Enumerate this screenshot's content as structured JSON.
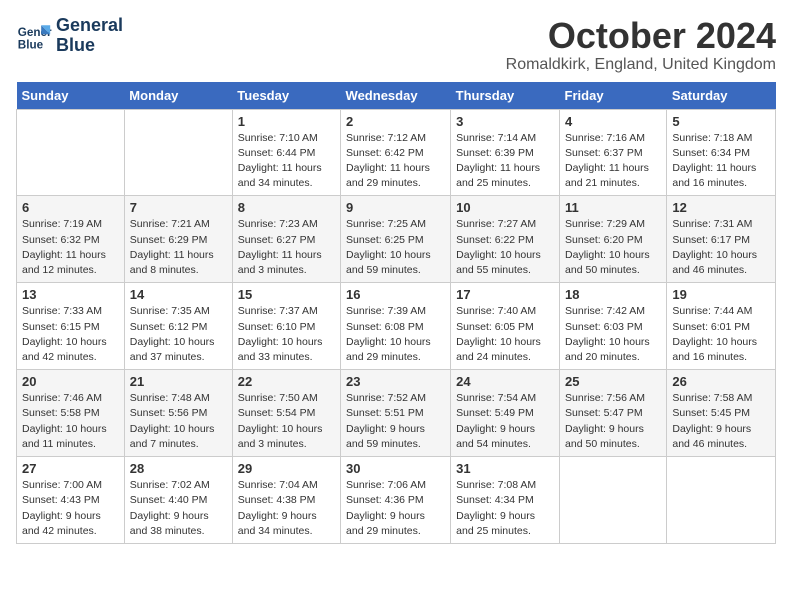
{
  "header": {
    "logo_line1": "General",
    "logo_line2": "Blue",
    "month_title": "October 2024",
    "location": "Romaldkirk, England, United Kingdom"
  },
  "weekdays": [
    "Sunday",
    "Monday",
    "Tuesday",
    "Wednesday",
    "Thursday",
    "Friday",
    "Saturday"
  ],
  "weeks": [
    [
      {
        "num": "",
        "info": ""
      },
      {
        "num": "",
        "info": ""
      },
      {
        "num": "1",
        "info": "Sunrise: 7:10 AM\nSunset: 6:44 PM\nDaylight: 11 hours\nand 34 minutes."
      },
      {
        "num": "2",
        "info": "Sunrise: 7:12 AM\nSunset: 6:42 PM\nDaylight: 11 hours\nand 29 minutes."
      },
      {
        "num": "3",
        "info": "Sunrise: 7:14 AM\nSunset: 6:39 PM\nDaylight: 11 hours\nand 25 minutes."
      },
      {
        "num": "4",
        "info": "Sunrise: 7:16 AM\nSunset: 6:37 PM\nDaylight: 11 hours\nand 21 minutes."
      },
      {
        "num": "5",
        "info": "Sunrise: 7:18 AM\nSunset: 6:34 PM\nDaylight: 11 hours\nand 16 minutes."
      }
    ],
    [
      {
        "num": "6",
        "info": "Sunrise: 7:19 AM\nSunset: 6:32 PM\nDaylight: 11 hours\nand 12 minutes."
      },
      {
        "num": "7",
        "info": "Sunrise: 7:21 AM\nSunset: 6:29 PM\nDaylight: 11 hours\nand 8 minutes."
      },
      {
        "num": "8",
        "info": "Sunrise: 7:23 AM\nSunset: 6:27 PM\nDaylight: 11 hours\nand 3 minutes."
      },
      {
        "num": "9",
        "info": "Sunrise: 7:25 AM\nSunset: 6:25 PM\nDaylight: 10 hours\nand 59 minutes."
      },
      {
        "num": "10",
        "info": "Sunrise: 7:27 AM\nSunset: 6:22 PM\nDaylight: 10 hours\nand 55 minutes."
      },
      {
        "num": "11",
        "info": "Sunrise: 7:29 AM\nSunset: 6:20 PM\nDaylight: 10 hours\nand 50 minutes."
      },
      {
        "num": "12",
        "info": "Sunrise: 7:31 AM\nSunset: 6:17 PM\nDaylight: 10 hours\nand 46 minutes."
      }
    ],
    [
      {
        "num": "13",
        "info": "Sunrise: 7:33 AM\nSunset: 6:15 PM\nDaylight: 10 hours\nand 42 minutes."
      },
      {
        "num": "14",
        "info": "Sunrise: 7:35 AM\nSunset: 6:12 PM\nDaylight: 10 hours\nand 37 minutes."
      },
      {
        "num": "15",
        "info": "Sunrise: 7:37 AM\nSunset: 6:10 PM\nDaylight: 10 hours\nand 33 minutes."
      },
      {
        "num": "16",
        "info": "Sunrise: 7:39 AM\nSunset: 6:08 PM\nDaylight: 10 hours\nand 29 minutes."
      },
      {
        "num": "17",
        "info": "Sunrise: 7:40 AM\nSunset: 6:05 PM\nDaylight: 10 hours\nand 24 minutes."
      },
      {
        "num": "18",
        "info": "Sunrise: 7:42 AM\nSunset: 6:03 PM\nDaylight: 10 hours\nand 20 minutes."
      },
      {
        "num": "19",
        "info": "Sunrise: 7:44 AM\nSunset: 6:01 PM\nDaylight: 10 hours\nand 16 minutes."
      }
    ],
    [
      {
        "num": "20",
        "info": "Sunrise: 7:46 AM\nSunset: 5:58 PM\nDaylight: 10 hours\nand 11 minutes."
      },
      {
        "num": "21",
        "info": "Sunrise: 7:48 AM\nSunset: 5:56 PM\nDaylight: 10 hours\nand 7 minutes."
      },
      {
        "num": "22",
        "info": "Sunrise: 7:50 AM\nSunset: 5:54 PM\nDaylight: 10 hours\nand 3 minutes."
      },
      {
        "num": "23",
        "info": "Sunrise: 7:52 AM\nSunset: 5:51 PM\nDaylight: 9 hours\nand 59 minutes."
      },
      {
        "num": "24",
        "info": "Sunrise: 7:54 AM\nSunset: 5:49 PM\nDaylight: 9 hours\nand 54 minutes."
      },
      {
        "num": "25",
        "info": "Sunrise: 7:56 AM\nSunset: 5:47 PM\nDaylight: 9 hours\nand 50 minutes."
      },
      {
        "num": "26",
        "info": "Sunrise: 7:58 AM\nSunset: 5:45 PM\nDaylight: 9 hours\nand 46 minutes."
      }
    ],
    [
      {
        "num": "27",
        "info": "Sunrise: 7:00 AM\nSunset: 4:43 PM\nDaylight: 9 hours\nand 42 minutes."
      },
      {
        "num": "28",
        "info": "Sunrise: 7:02 AM\nSunset: 4:40 PM\nDaylight: 9 hours\nand 38 minutes."
      },
      {
        "num": "29",
        "info": "Sunrise: 7:04 AM\nSunset: 4:38 PM\nDaylight: 9 hours\nand 34 minutes."
      },
      {
        "num": "30",
        "info": "Sunrise: 7:06 AM\nSunset: 4:36 PM\nDaylight: 9 hours\nand 29 minutes."
      },
      {
        "num": "31",
        "info": "Sunrise: 7:08 AM\nSunset: 4:34 PM\nDaylight: 9 hours\nand 25 minutes."
      },
      {
        "num": "",
        "info": ""
      },
      {
        "num": "",
        "info": ""
      }
    ]
  ]
}
